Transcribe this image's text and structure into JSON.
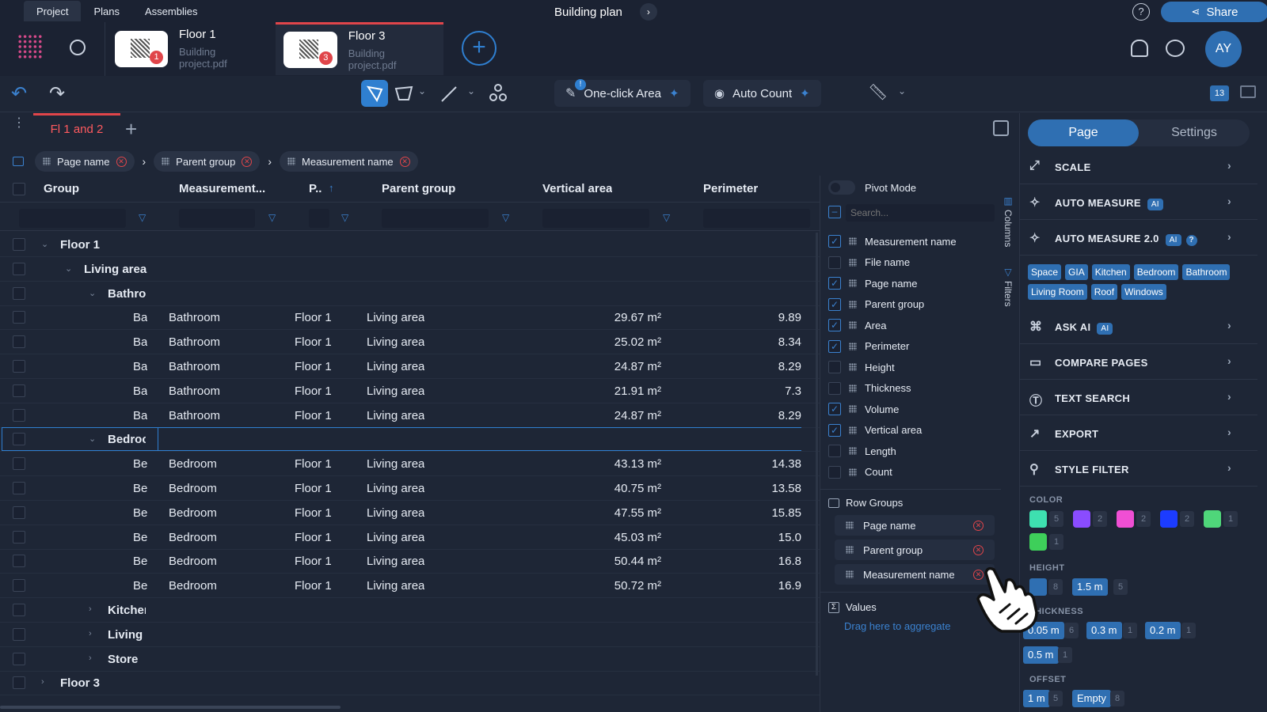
{
  "top_nav": {
    "tabs": [
      "Project",
      "Plans",
      "Assemblies"
    ],
    "title": "Building plan",
    "share_label": "Share",
    "help_icon": "?"
  },
  "files": [
    {
      "name": "Floor 1",
      "sub": "Building project.pdf",
      "badge": "1"
    },
    {
      "name": "Floor 3",
      "sub": "Building project.pdf",
      "badge": "3"
    }
  ],
  "avatar": "AY",
  "toolbar": {
    "one_click": "One-click Area",
    "auto_count": "Auto Count",
    "one_click_badge": "!",
    "counter": "13"
  },
  "tabs": {
    "active": "Fl 1 and 2"
  },
  "group_chips": [
    "Page name",
    "Parent group",
    "Measurement name"
  ],
  "grid": {
    "headers": [
      "Group",
      "Measurement...",
      "P..",
      "Parent group",
      "Vertical area",
      "Perimeter"
    ],
    "sort_arrow": "↑",
    "rows": [
      {
        "level": 0,
        "group": "Floor 1",
        "expanded": true
      },
      {
        "level": 1,
        "group": "Living area",
        "expanded": true
      },
      {
        "level": 2,
        "group": "Bathro",
        "expanded": true
      },
      {
        "leaf": true,
        "group": "Ba",
        "meas": "Bathroom",
        "page": "Floor 1",
        "parent": "Living area",
        "va": "29.67 m²",
        "per": "9.89"
      },
      {
        "leaf": true,
        "group": "Ba",
        "meas": "Bathroom",
        "page": "Floor 1",
        "parent": "Living area",
        "va": "25.02 m²",
        "per": "8.34"
      },
      {
        "leaf": true,
        "group": "Ba",
        "meas": "Bathroom",
        "page": "Floor 1",
        "parent": "Living area",
        "va": "24.87 m²",
        "per": "8.29"
      },
      {
        "leaf": true,
        "group": "Ba",
        "meas": "Bathroom",
        "page": "Floor 1",
        "parent": "Living area",
        "va": "21.91 m²",
        "per": "7.3"
      },
      {
        "leaf": true,
        "group": "Ba",
        "meas": "Bathroom",
        "page": "Floor 1",
        "parent": "Living area",
        "va": "24.87 m²",
        "per": "8.29"
      },
      {
        "level": 2,
        "group": "Bedroc",
        "expanded": true,
        "selected": true
      },
      {
        "leaf": true,
        "group": "Be",
        "meas": "Bedroom",
        "page": "Floor 1",
        "parent": "Living area",
        "va": "43.13 m²",
        "per": "14.38"
      },
      {
        "leaf": true,
        "group": "Be",
        "meas": "Bedroom",
        "page": "Floor 1",
        "parent": "Living area",
        "va": "40.75 m²",
        "per": "13.58"
      },
      {
        "leaf": true,
        "group": "Be",
        "meas": "Bedroom",
        "page": "Floor 1",
        "parent": "Living area",
        "va": "47.55 m²",
        "per": "15.85"
      },
      {
        "leaf": true,
        "group": "Be",
        "meas": "Bedroom",
        "page": "Floor 1",
        "parent": "Living area",
        "va": "45.03 m²",
        "per": "15.0"
      },
      {
        "leaf": true,
        "group": "Be",
        "meas": "Bedroom",
        "page": "Floor 1",
        "parent": "Living area",
        "va": "50.44 m²",
        "per": "16.8"
      },
      {
        "leaf": true,
        "group": "Be",
        "meas": "Bedroom",
        "page": "Floor 1",
        "parent": "Living area",
        "va": "50.72 m²",
        "per": "16.9"
      },
      {
        "level": 2,
        "group": "Kitcher",
        "expanded": false
      },
      {
        "level": 2,
        "group": "Living l",
        "expanded": false
      },
      {
        "level": 2,
        "group": "Store",
        "expanded": false
      },
      {
        "level": 0,
        "group": "Floor 3",
        "expanded": false
      }
    ]
  },
  "column_panel": {
    "pivot_mode": "Pivot Mode",
    "search_placeholder": "Search...",
    "columns": [
      {
        "label": "Measurement name",
        "checked": true
      },
      {
        "label": "File name",
        "checked": false
      },
      {
        "label": "Page name",
        "checked": true
      },
      {
        "label": "Parent group",
        "checked": true
      },
      {
        "label": "Area",
        "checked": true
      },
      {
        "label": "Perimeter",
        "checked": true
      },
      {
        "label": "Height",
        "checked": false
      },
      {
        "label": "Thickness",
        "checked": false
      },
      {
        "label": "Volume",
        "checked": true
      },
      {
        "label": "Vertical area",
        "checked": true
      },
      {
        "label": "Length",
        "checked": false
      },
      {
        "label": "Count",
        "checked": false
      }
    ],
    "row_groups_title": "Row Groups",
    "row_groups": [
      "Page name",
      "Parent group",
      "Measurement name"
    ],
    "values_title": "Values",
    "values_hint": "Drag here to aggregate",
    "side_tabs": [
      "Columns",
      "Filters"
    ]
  },
  "props": {
    "seg_page": "Page",
    "seg_settings": "Settings",
    "items": [
      {
        "label": "SCALE",
        "ai": ""
      },
      {
        "label": "AUTO MEASURE",
        "ai": "AI"
      },
      {
        "label": "AUTO MEASURE 2.0",
        "ai": "AI"
      },
      {
        "label": "ASK AI",
        "ai": "AI"
      },
      {
        "label": "COMPARE PAGES",
        "ai": ""
      },
      {
        "label": "TEXT SEARCH",
        "ai": ""
      },
      {
        "label": "EXPORT",
        "ai": ""
      },
      {
        "label": "STYLE FILTER",
        "ai": ""
      }
    ],
    "auto_tags": [
      "Space",
      "GIA",
      "Kitchen",
      "Bedroom",
      "Bathroom",
      "Living Room",
      "Roof",
      "Windows"
    ],
    "color_label": "COLOR",
    "colors": [
      {
        "hex": "#3ee0b0",
        "n": "5"
      },
      {
        "hex": "#8a4cff",
        "n": "2"
      },
      {
        "hex": "#f04fd4",
        "n": "2"
      },
      {
        "hex": "#1c3cff",
        "n": "2"
      },
      {
        "hex": "#4fd67a",
        "n": "1"
      },
      {
        "hex": "#3ecf5a",
        "n": "1"
      }
    ],
    "height_label": "HEIGHT",
    "height_vals": [
      {
        "v": "",
        "n": "8"
      },
      {
        "v": "1.5 m",
        "n": "5"
      }
    ],
    "thickness_label": "THICKNESS",
    "thickness_vals": [
      {
        "v": "0.05 m",
        "n": "6"
      },
      {
        "v": "0.3 m",
        "n": "1"
      },
      {
        "v": "0.2 m",
        "n": "1"
      },
      {
        "v": "0.5 m",
        "n": "1"
      }
    ],
    "offset_label": "OFFSET",
    "offset_vals": [
      {
        "v": "1 m",
        "n": "5"
      },
      {
        "v": "Empty",
        "n": "8"
      }
    ]
  }
}
